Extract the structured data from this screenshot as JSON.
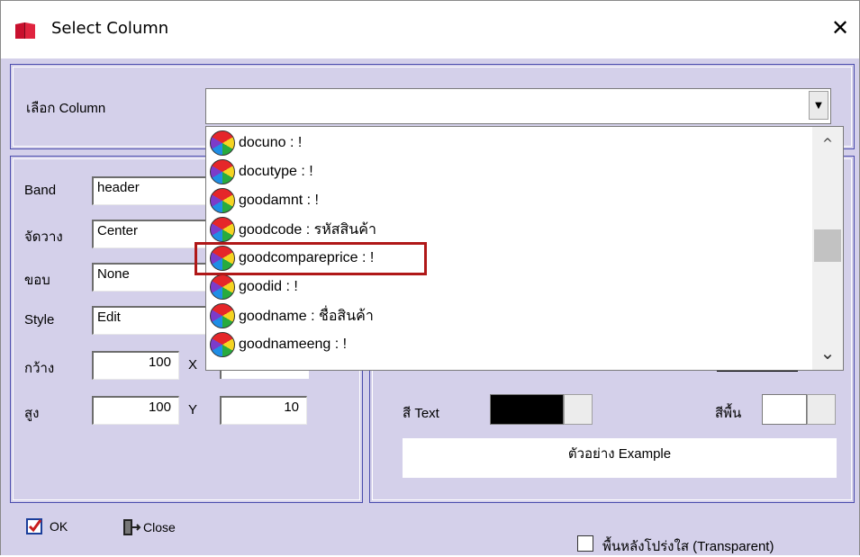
{
  "window": {
    "title": "Select Column",
    "close_glyph": "✕",
    "icon": "book-icon"
  },
  "column_picker": {
    "label": "เลือก Column",
    "value": "",
    "dropdown_arrow": "▼"
  },
  "dropdown": {
    "items": [
      {
        "label": "docuno : !"
      },
      {
        "label": "docutype : !"
      },
      {
        "label": "goodamnt : !"
      },
      {
        "label": "goodcode : รหัสสินค้า"
      },
      {
        "label": "goodcompareprice : !"
      },
      {
        "label": "goodid : !"
      },
      {
        "label": "goodname : ชื่อสินค้า"
      },
      {
        "label": "goodnameeng : !"
      }
    ],
    "highlighted_index": 4,
    "scroll_up": "^",
    "scroll_down": "⌄"
  },
  "properties": {
    "band_label": "Band",
    "band_value": "header",
    "align_label": "จัดวาง",
    "align_value": "Center",
    "border_label": "ขอบ",
    "border_value": "None",
    "style_label": "Style",
    "style_value": "Edit",
    "width_label": "กว้าง",
    "width_value": "100",
    "x_label": "X",
    "height_label": "สูง",
    "height_value": "100",
    "y_label": "Y",
    "y_value": "10"
  },
  "colors": {
    "text_color_label": "สี Text",
    "text_color": "#000000",
    "bg_color_label": "สีพื้น",
    "bg_color": "#ffffff",
    "sample_text": "ตัวอย่าง Example"
  },
  "footer": {
    "ok_label": "OK",
    "close_label": "Close",
    "transparent_label": "พื้นหลังโปร่งใส (Transparent)",
    "transparent_checked": false
  }
}
